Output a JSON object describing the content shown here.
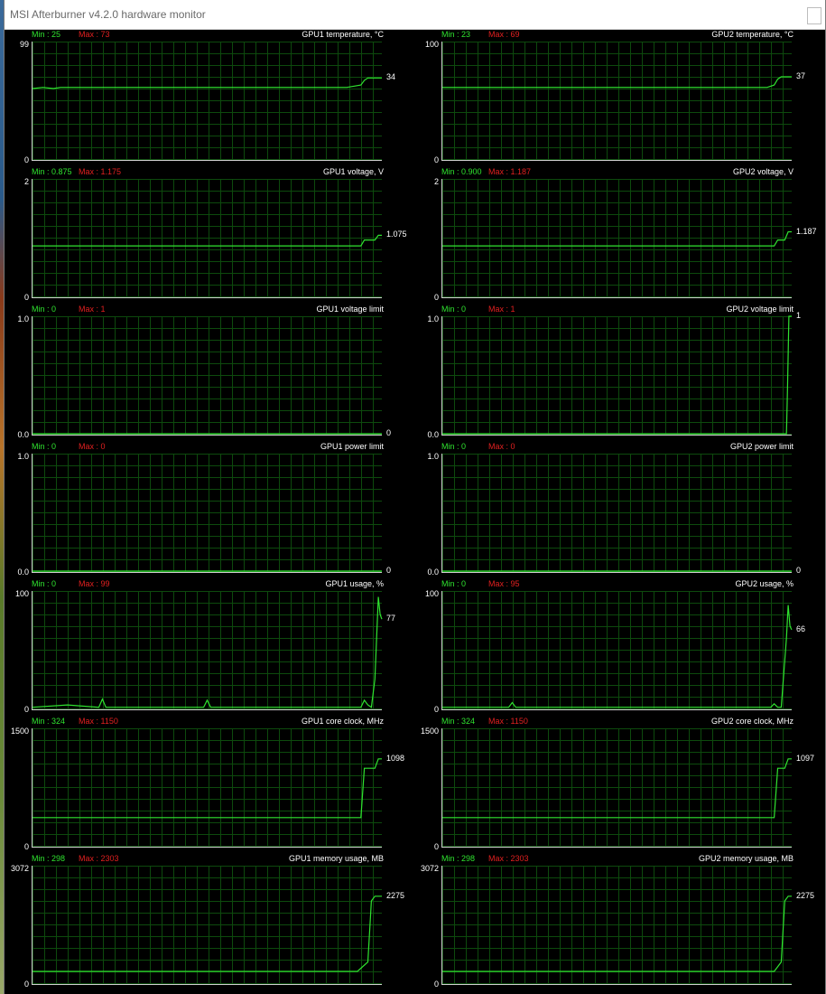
{
  "window": {
    "title": "MSI Afterburner v4.2.0 hardware monitor"
  },
  "graphs": [
    {
      "id": "gpu1-temp",
      "name": "GPU1 temperature, °C",
      "min_label": "Min : 25",
      "max_label": "Max : 73",
      "y_top": "99",
      "y_bottom": "0",
      "current": "34",
      "scale_max": 99,
      "current_value": 34
    },
    {
      "id": "gpu2-temp",
      "name": "GPU2 temperature, °C",
      "min_label": "Min : 23",
      "max_label": "Max : 69",
      "y_top": "100",
      "y_bottom": "0",
      "current": "37",
      "scale_max": 100,
      "current_value": 37
    },
    {
      "id": "gpu1-voltage",
      "name": "GPU1 voltage, V",
      "min_label": "Min : 0.875",
      "max_label": "Max : 1.175",
      "y_top": "2",
      "y_bottom": "0",
      "current": "1.075",
      "scale_max": 2,
      "current_value": 1.075
    },
    {
      "id": "gpu2-voltage",
      "name": "GPU2 voltage, V",
      "min_label": "Min : 0.900",
      "max_label": "Max : 1.187",
      "y_top": "2",
      "y_bottom": "0",
      "current": "1.187",
      "scale_max": 2,
      "current_value": 1.187
    },
    {
      "id": "gpu1-voltage-limit",
      "name": "GPU1 voltage limit",
      "min_label": "Min : 0",
      "max_label": "Max : 1",
      "y_top": "1.0",
      "y_bottom": "0.0",
      "current": "0",
      "scale_max": 1,
      "current_value": 0
    },
    {
      "id": "gpu2-voltage-limit",
      "name": "GPU2 voltage limit",
      "min_label": "Min : 0",
      "max_label": "Max : 1",
      "y_top": "1.0",
      "y_bottom": "0.0",
      "current": "1",
      "scale_max": 1,
      "current_value": 1
    },
    {
      "id": "gpu1-power-limit",
      "name": "GPU1 power limit",
      "min_label": "Min : 0",
      "max_label": "Max : 0",
      "y_top": "1.0",
      "y_bottom": "0.0",
      "current": "0",
      "scale_max": 1,
      "current_value": 0
    },
    {
      "id": "gpu2-power-limit",
      "name": "GPU2 power limit",
      "min_label": "Min : 0",
      "max_label": "Max : 0",
      "y_top": "1.0",
      "y_bottom": "0.0",
      "current": "0",
      "scale_max": 1,
      "current_value": 0
    },
    {
      "id": "gpu1-usage",
      "name": "GPU1 usage, %",
      "min_label": "Min : 0",
      "max_label": "Max : 99",
      "y_top": "100",
      "y_bottom": "0",
      "current": "77",
      "scale_max": 100,
      "current_value": 77
    },
    {
      "id": "gpu2-usage",
      "name": "GPU2 usage, %",
      "min_label": "Min : 0",
      "max_label": "Max : 95",
      "y_top": "100",
      "y_bottom": "0",
      "current": "66",
      "scale_max": 100,
      "current_value": 66
    },
    {
      "id": "gpu1-core-clock",
      "name": "GPU1 core clock, MHz",
      "min_label": "Min : 324",
      "max_label": "Max : 1150",
      "y_top": "1500",
      "y_bottom": "0",
      "current": "1098",
      "scale_max": 1500,
      "current_value": 1098
    },
    {
      "id": "gpu2-core-clock",
      "name": "GPU2 core clock, MHz",
      "min_label": "Min : 324",
      "max_label": "Max : 1150",
      "y_top": "1500",
      "y_bottom": "0",
      "current": "1097",
      "scale_max": 1500,
      "current_value": 1097
    },
    {
      "id": "gpu1-memory-usage",
      "name": "GPU1 memory usage, MB",
      "min_label": "Min : 298",
      "max_label": "Max : 2303",
      "y_top": "3072",
      "y_bottom": "0",
      "current": "2275",
      "scale_max": 3072,
      "current_value": 2275
    },
    {
      "id": "gpu2-memory-usage",
      "name": "GPU2 memory usage, MB",
      "min_label": "Min : 298",
      "max_label": "Max : 2303",
      "y_top": "3072",
      "y_bottom": "0",
      "current": "2275",
      "scale_max": 3072,
      "current_value": 2275
    }
  ],
  "colors": {
    "line": "#2fe32f",
    "grid": "#0d4a0d",
    "min": "#2fe32f",
    "max": "#e22020"
  }
}
